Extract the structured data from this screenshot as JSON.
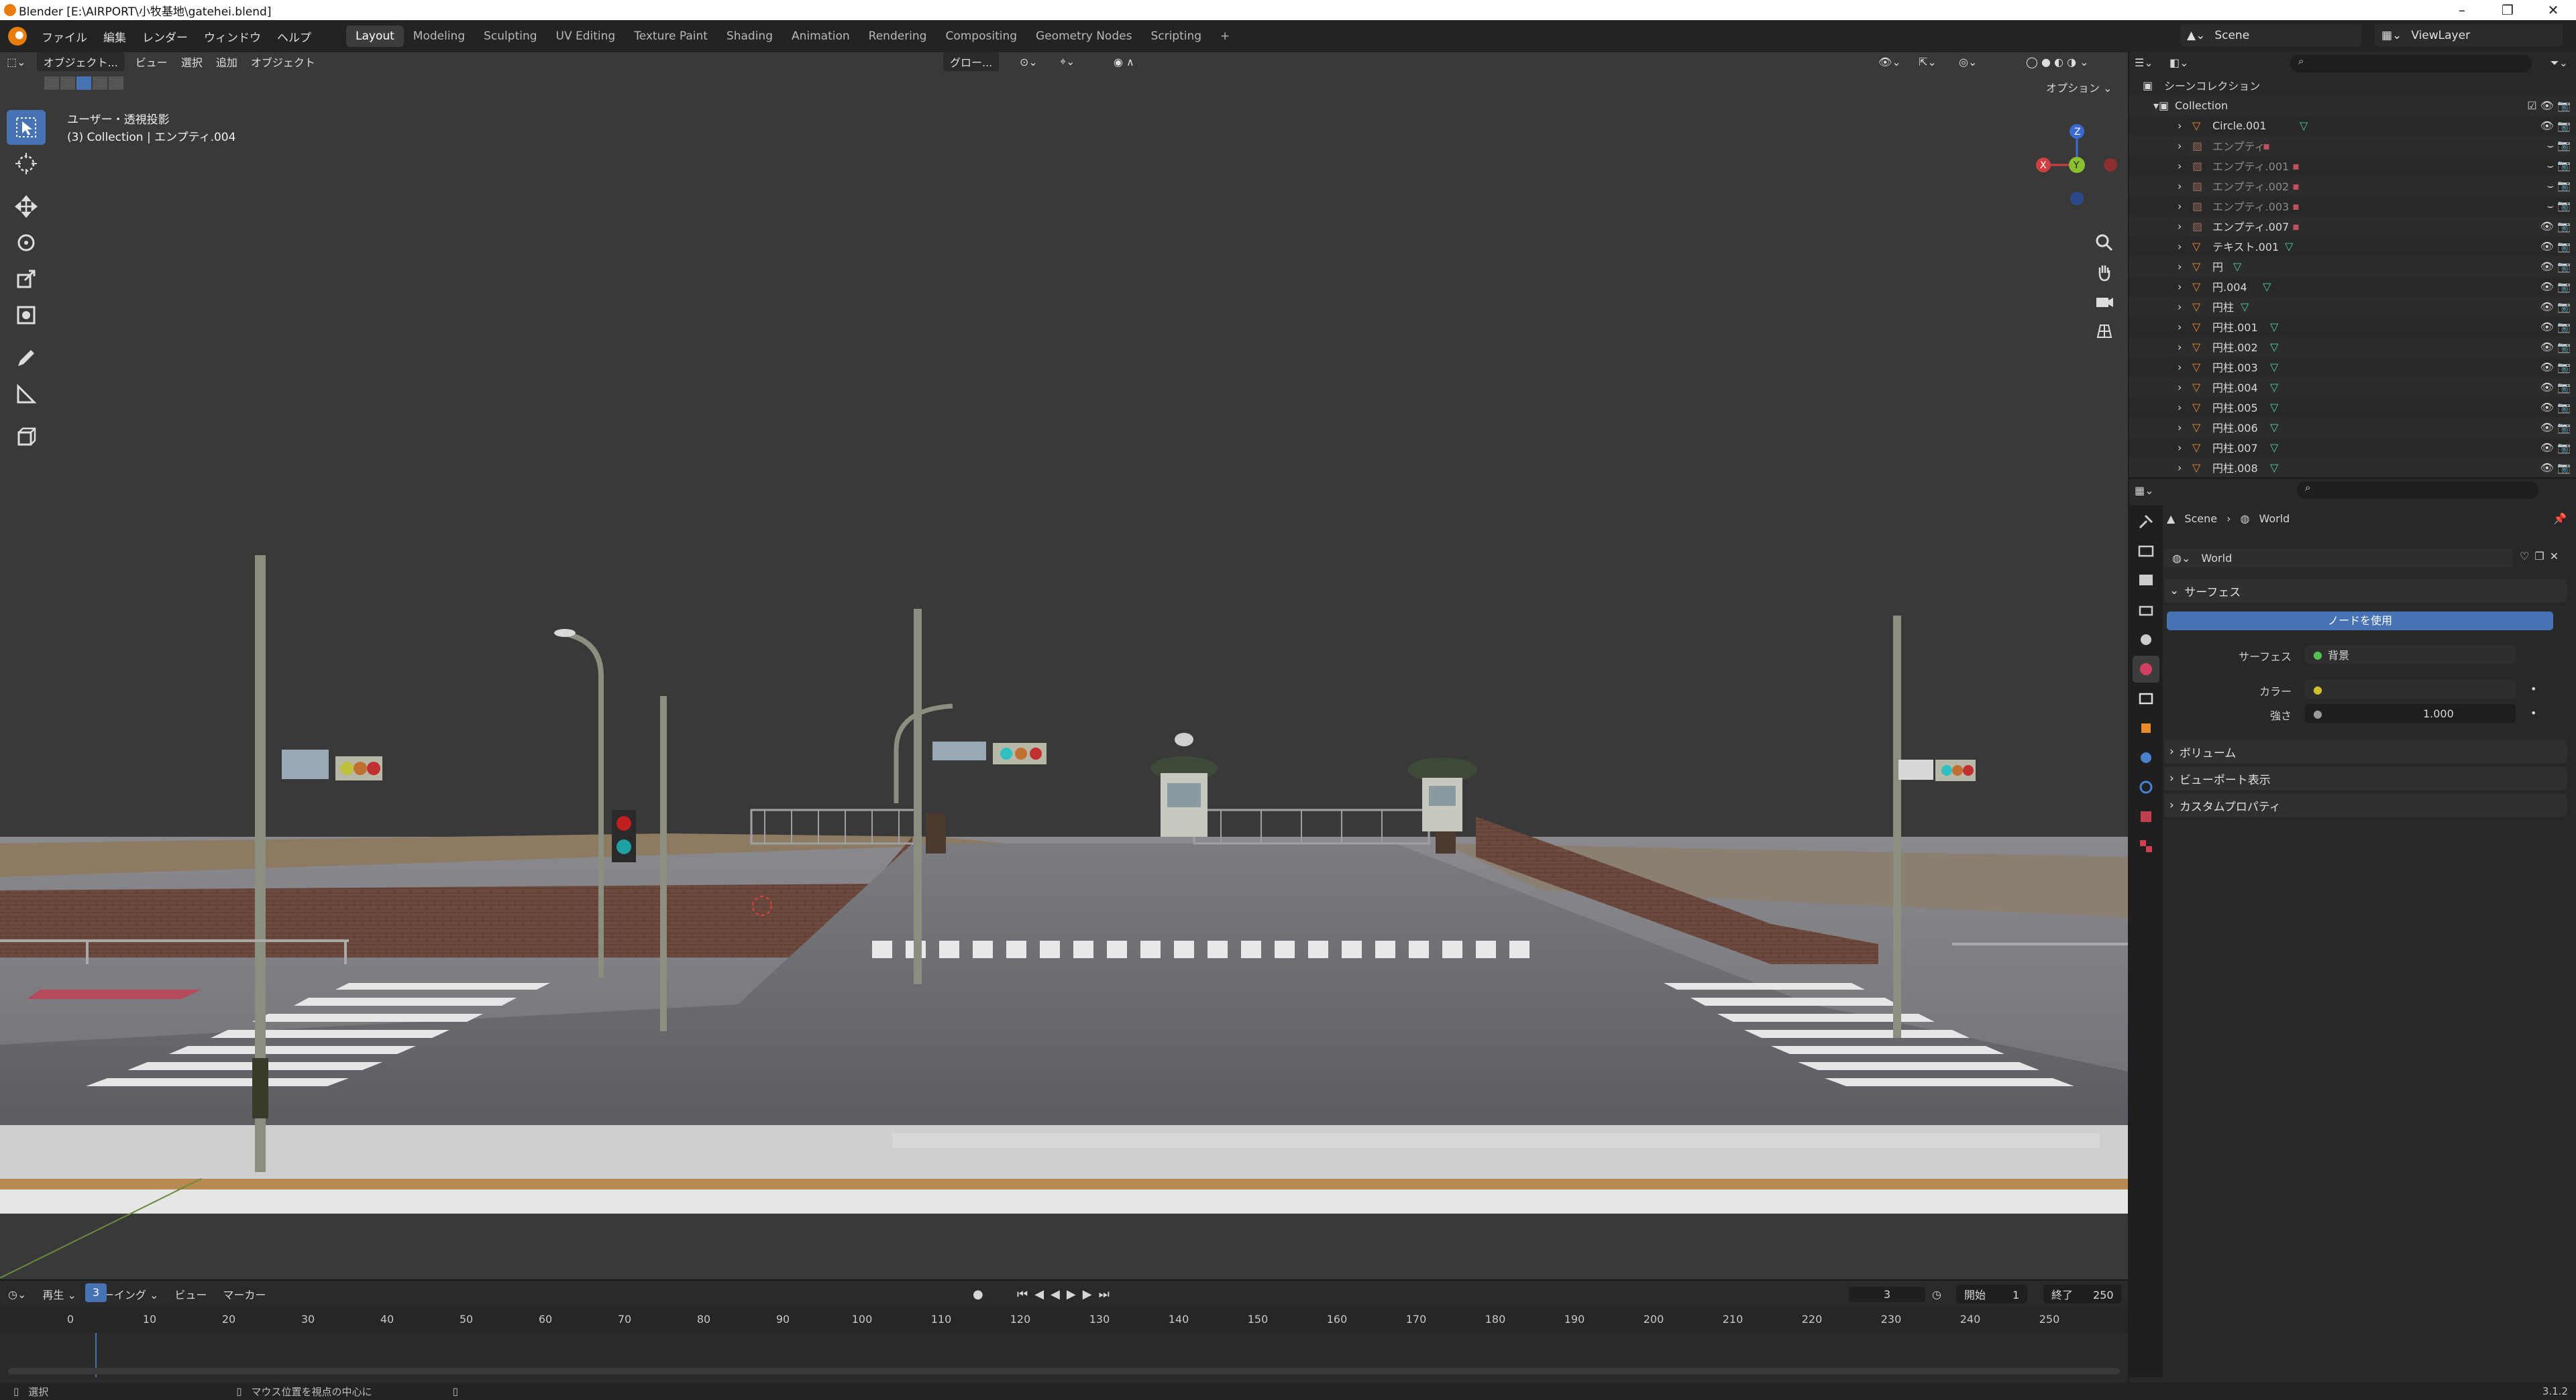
{
  "window": {
    "title": "Blender [E:\\AIRPORT\\小牧基地\\gatehei.blend]",
    "controls": [
      "–",
      "❐",
      "✕"
    ]
  },
  "menu": [
    "ファイル",
    "編集",
    "レンダー",
    "ウィンドウ",
    "ヘルプ"
  ],
  "workspaces": [
    "Layout",
    "Modeling",
    "Sculpting",
    "UV Editing",
    "Texture Paint",
    "Shading",
    "Animation",
    "Rendering",
    "Compositing",
    "Geometry Nodes",
    "Scripting"
  ],
  "active_workspace": "Layout",
  "add_workspace": "+",
  "scene_selector": {
    "scene": "Scene",
    "viewlayer": "ViewLayer"
  },
  "viewport": {
    "mode": "オブジェクト...",
    "menus": [
      "ビュー",
      "選択",
      "追加",
      "オブジェクト"
    ],
    "transform": "グロー...",
    "options": "オプション ⌄",
    "overlay_line1": "ユーザー・透視投影",
    "overlay_line2": "(3) Collection | エンプティ.004",
    "gizmo": {
      "x": "X",
      "y": "Y",
      "z": "Z"
    }
  },
  "timeline": {
    "menus": [
      "再生 ⌄",
      "キーイング ⌄",
      "ビュー",
      "マーカー"
    ],
    "current_frame": "3",
    "start_label": "開始",
    "start": "1",
    "end_label": "終了",
    "end": "250",
    "ruler": [
      "0",
      "10",
      "20",
      "30",
      "40",
      "50",
      "60",
      "70",
      "80",
      "90",
      "100",
      "110",
      "120",
      "130",
      "140",
      "150",
      "160",
      "170",
      "180",
      "190",
      "200",
      "210",
      "220",
      "230",
      "240",
      "250"
    ]
  },
  "status": {
    "select": "選択",
    "center": "マウス位置を視点の中心に",
    "version": "3.1.2"
  },
  "outliner": {
    "root": "シーンコレクション",
    "collection": "Collection",
    "items": [
      {
        "name": "Circle.001",
        "kind": "mesh",
        "dim": false
      },
      {
        "name": "エンプティ",
        "kind": "empty",
        "dim": true
      },
      {
        "name": "エンプティ.001",
        "kind": "empty",
        "dim": true
      },
      {
        "name": "エンプティ.002",
        "kind": "empty",
        "dim": true
      },
      {
        "name": "エンプティ.003",
        "kind": "empty",
        "dim": true
      },
      {
        "name": "エンプティ.007",
        "kind": "empty",
        "dim": false
      },
      {
        "name": "テキスト.001",
        "kind": "mesh",
        "dim": false
      },
      {
        "name": "円",
        "kind": "mesh",
        "dim": false
      },
      {
        "name": "円.004",
        "kind": "mesh",
        "dim": false
      },
      {
        "name": "円柱",
        "kind": "mesh",
        "dim": false
      },
      {
        "name": "円柱.001",
        "kind": "mesh",
        "dim": false
      },
      {
        "name": "円柱.002",
        "kind": "mesh",
        "dim": false
      },
      {
        "name": "円柱.003",
        "kind": "mesh",
        "dim": false
      },
      {
        "name": "円柱.004",
        "kind": "mesh",
        "dim": false
      },
      {
        "name": "円柱.005",
        "kind": "mesh",
        "dim": false
      },
      {
        "name": "円柱.006",
        "kind": "mesh",
        "dim": false
      },
      {
        "name": "円柱.007",
        "kind": "mesh",
        "dim": false
      },
      {
        "name": "円柱.008",
        "kind": "mesh",
        "dim": false
      }
    ]
  },
  "properties": {
    "breadcrumb": [
      "Scene",
      "World"
    ],
    "world_name": "World",
    "surface_panel": "サーフェス",
    "use_nodes": "ノードを使用",
    "surface_label": "サーフェス",
    "surface_value": "背景",
    "color_label": "カラー",
    "strength_label": "強さ",
    "strength_value": "1.000",
    "volume_panel": "ボリューム",
    "viewport_panel": "ビューポート表示",
    "custom_panel": "カスタムプロパティ"
  },
  "colors": {
    "accent": "#4772b3",
    "mesh_icon": "#e98b2b",
    "empty_icon": "#9a6a5a",
    "data_icon": "#4fcfa0"
  }
}
